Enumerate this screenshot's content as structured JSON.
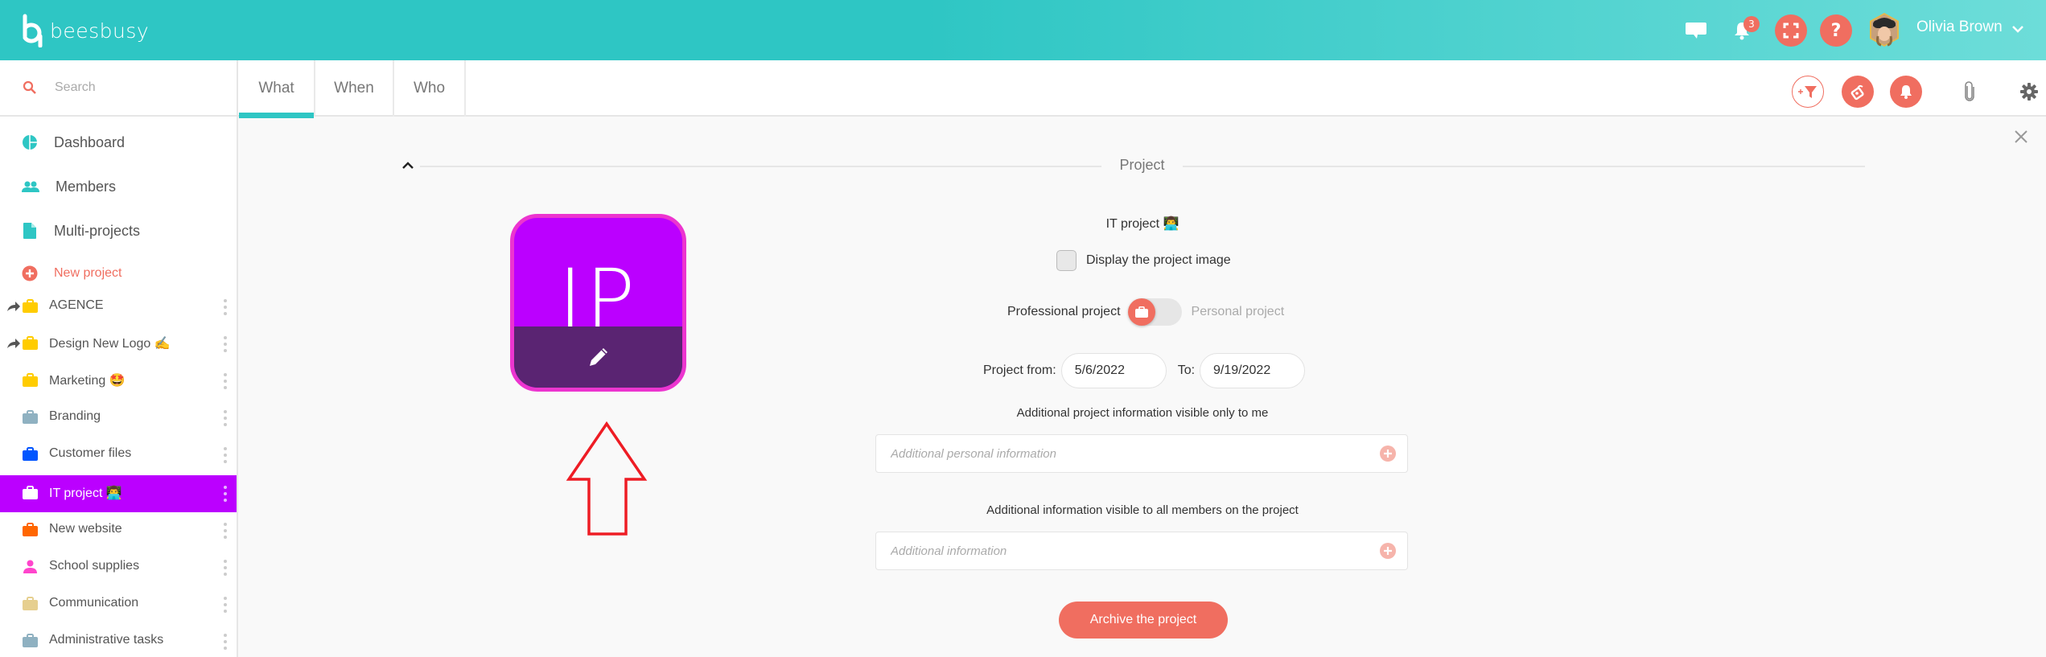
{
  "app": {
    "brand": "beesbusy",
    "accent_color": "#2ec6c4",
    "action_color": "#f06e60"
  },
  "header": {
    "notifications_count": "3",
    "user_name": "Olivia Brown",
    "icons": [
      "chat-icon",
      "bell-icon",
      "fullscreen-icon",
      "help-icon",
      "avatar",
      "chevron-down-icon"
    ],
    "help_glyph": "?"
  },
  "sidebar": {
    "search_placeholder": "Search",
    "nav": [
      {
        "label": "Dashboard",
        "icon": "dashboard-icon"
      },
      {
        "label": "Members",
        "icon": "members-icon"
      },
      {
        "label": "Multi-projects",
        "icon": "document-icon"
      },
      {
        "label": "New project",
        "icon": "plus-circle-icon"
      }
    ],
    "projects": [
      {
        "label": "AGENCE",
        "color": "#ffcc00",
        "shared": true
      },
      {
        "label": "Design New Logo ✍️",
        "color": "#ffcc00",
        "shared": true
      },
      {
        "label": "Marketing 🤩",
        "color": "#ffcc00",
        "shared": false
      },
      {
        "label": "Branding",
        "color": "#8fb1c1",
        "shared": false
      },
      {
        "label": "Customer files",
        "color": "#0055ff",
        "shared": false
      },
      {
        "label": "IT project 👨‍💻",
        "color": "#bb00ff",
        "shared": false,
        "active": true
      },
      {
        "label": "New website",
        "color": "#ff6600",
        "shared": false
      },
      {
        "label": "School supplies",
        "color": "#ff44cc",
        "shared": false,
        "icon": "person"
      },
      {
        "label": "Communication",
        "color": "#e6cf8f",
        "shared": false
      },
      {
        "label": "Administrative tasks",
        "color": "#8fb1c1",
        "shared": false
      }
    ]
  },
  "tabs": [
    {
      "label": "What",
      "active": true
    },
    {
      "label": "When",
      "active": false
    },
    {
      "label": "Who",
      "active": false
    }
  ],
  "toolbar_icons": [
    "add-filter-icon",
    "tag-icon",
    "bell-icon",
    "paperclip-icon",
    "gear-icon"
  ],
  "project": {
    "section_title": "Project",
    "name": "IT project 👨‍💻",
    "initials": "IP",
    "image_color": "#bb00ff",
    "image_border_color": "#ec35cf",
    "display_image_label": "Display the project image",
    "display_image_checked": false,
    "professional_label": "Professional project",
    "personal_label": "Personal project",
    "type_selected": "Professional project",
    "from_label": "Project from:",
    "from_value": "5/6/2022",
    "to_label": "To:",
    "to_value": "9/19/2022",
    "personal_info_label": "Additional project information visible only to me",
    "personal_info_placeholder": "Additional personal information",
    "shared_info_label": "Additional information visible to all members on the project",
    "shared_info_placeholder": "Additional information",
    "archive_label": "Archive the project"
  },
  "annotation": {
    "arrow_color": "#ee1c24",
    "arrow_direction": "up"
  }
}
